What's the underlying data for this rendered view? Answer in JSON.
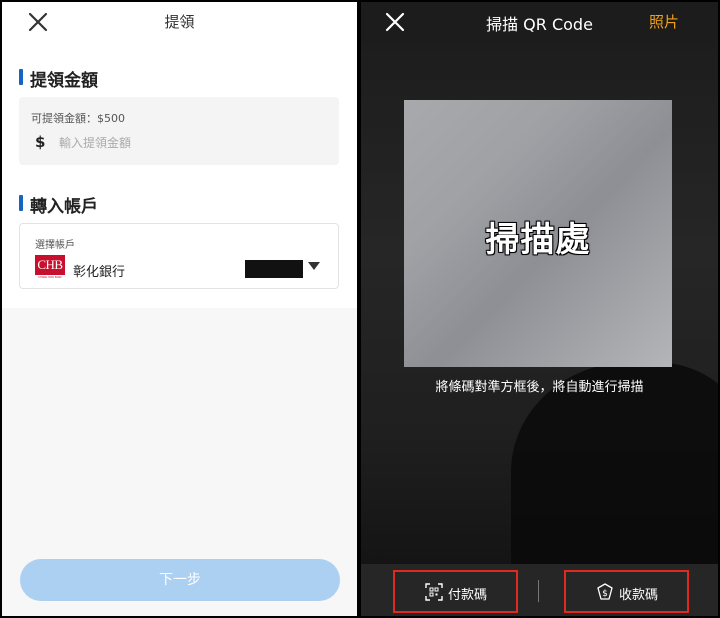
{
  "left_screen": {
    "header": {
      "title": "提領"
    },
    "amount_section": {
      "title": "提領金額",
      "available_label": "可提領金額：$500",
      "currency_symbol": "$",
      "input_placeholder": "輸入提領金額",
      "input_value": ""
    },
    "account_section": {
      "title": "轉入帳戶",
      "select_label": "選擇帳戶",
      "bank_logo_text": "CHB",
      "bank_logo_subtext": "CHANG HWA BANK",
      "bank_name": "彰化銀行"
    },
    "next_button": "下一步",
    "colors": {
      "accent": "#1565c0",
      "button_disabled": "#abd0f1"
    }
  },
  "right_screen": {
    "header": {
      "title": "掃描 QR Code",
      "photo_link": "照片"
    },
    "scan_overlay_text": "掃描處",
    "instruction": "將條碼對準方框後，將自動進行掃描",
    "tabs": [
      {
        "label": "付款碼",
        "icon": "qr-scan-icon"
      },
      {
        "label": "收款碼",
        "icon": "shield-dollar-icon"
      }
    ],
    "colors": {
      "photo_link": "#f0a11c",
      "highlight_border": "#e02a1d"
    }
  }
}
